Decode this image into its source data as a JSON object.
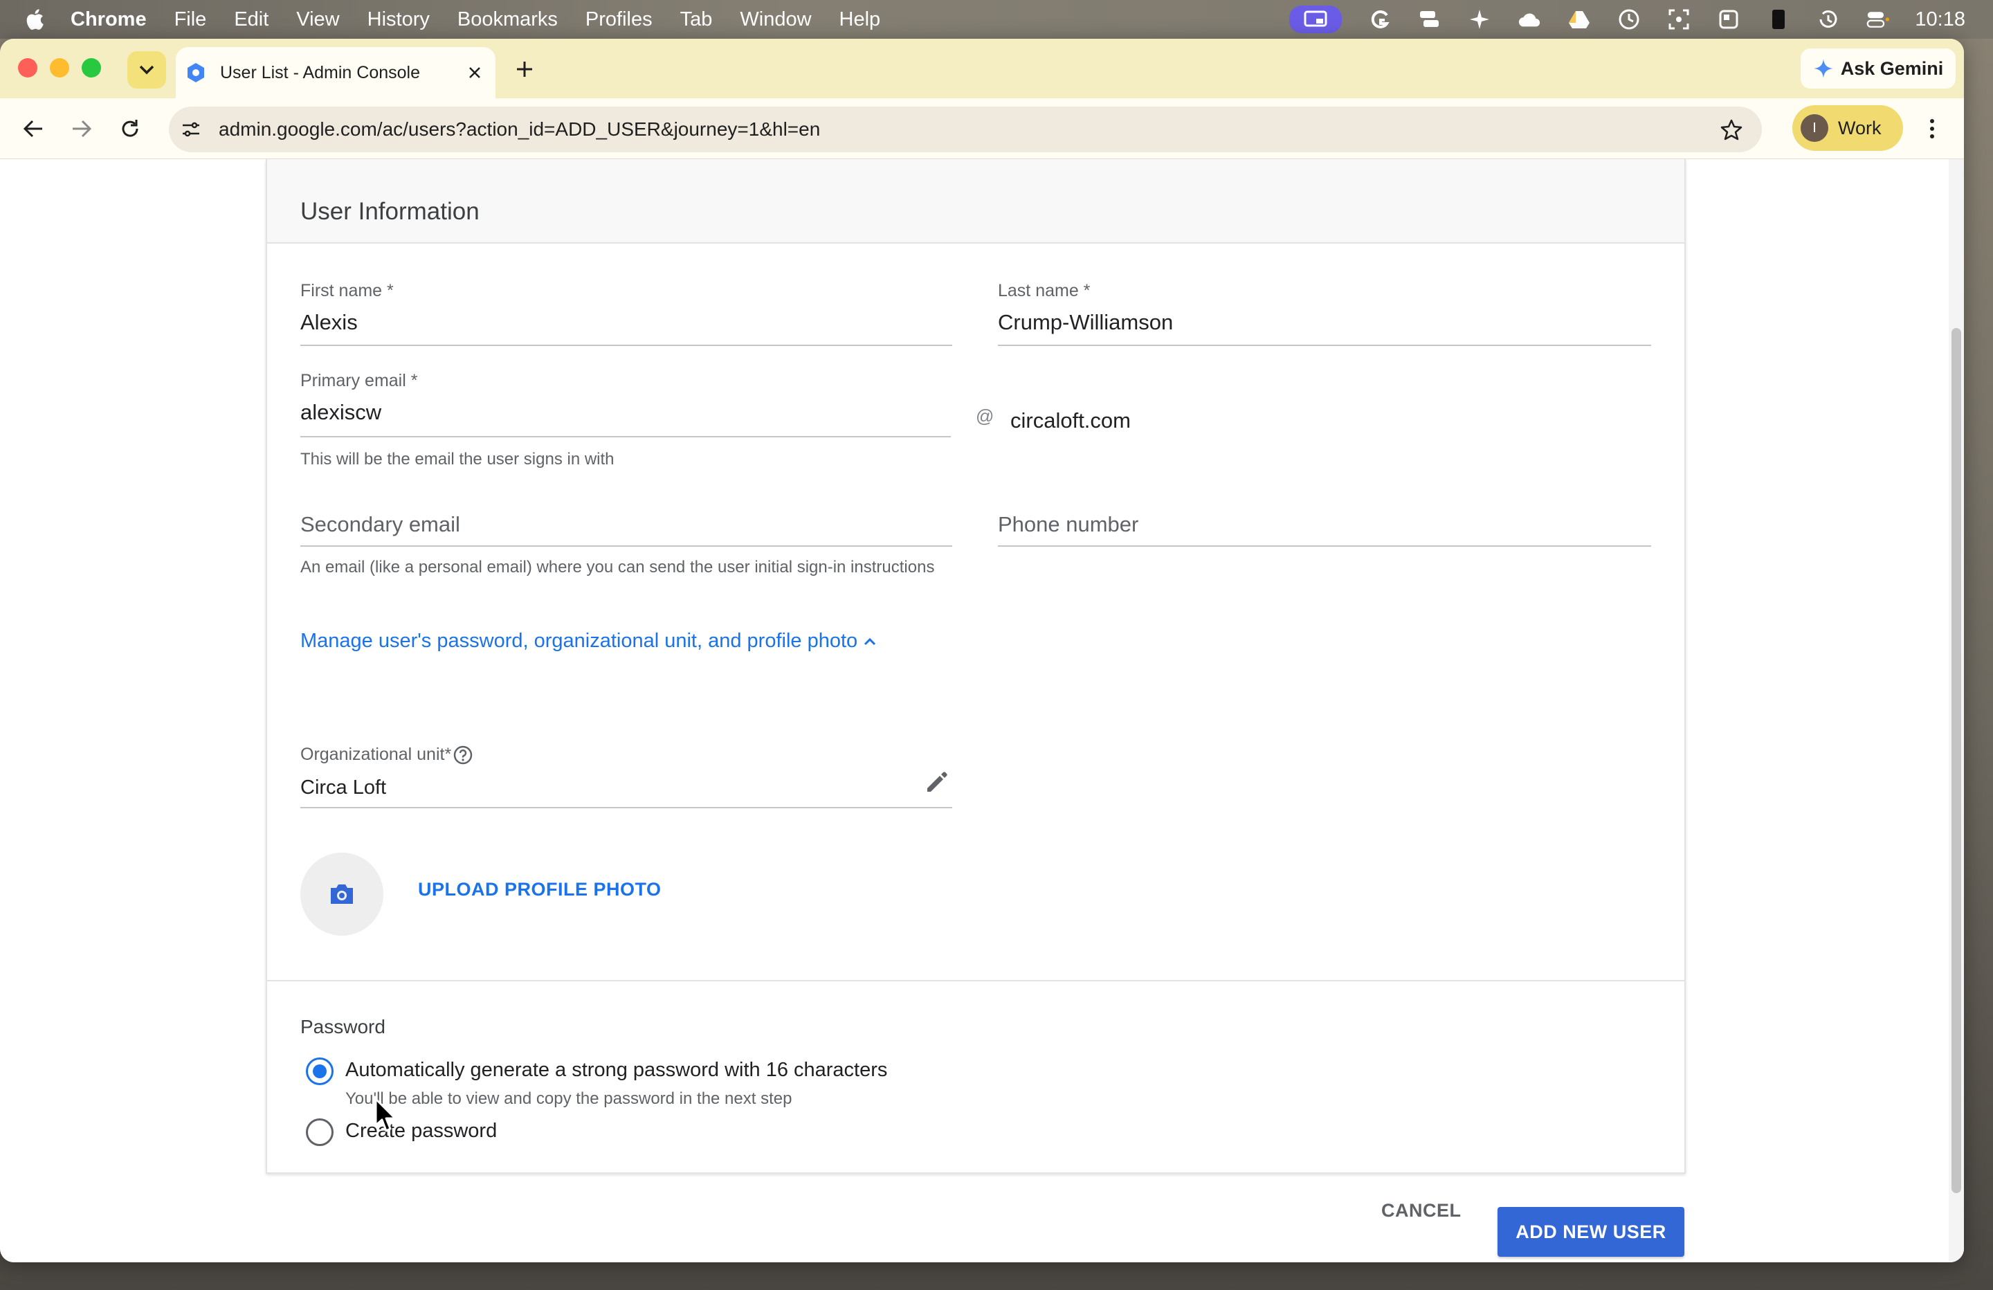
{
  "menubar": {
    "app_name": "Chrome",
    "items": [
      "File",
      "Edit",
      "View",
      "History",
      "Bookmarks",
      "Profiles",
      "Tab",
      "Window",
      "Help"
    ],
    "clock": "10:18"
  },
  "browser": {
    "tab_title": "User List - Admin Console",
    "url": "admin.google.com/ac/users?action_id=ADD_USER&journey=1&hl=en",
    "gemini_label": "Ask Gemini",
    "profile_initial": "I",
    "profile_label": "Work"
  },
  "form": {
    "section_title": "User Information",
    "first_name": {
      "label": "First name *",
      "value": "Alexis"
    },
    "last_name": {
      "label": "Last name *",
      "value": "Crump-Williamson"
    },
    "primary_email": {
      "label": "Primary email *",
      "value": "alexiscw",
      "at": "@",
      "domain": "circaloft.com",
      "hint": "This will be the email the user signs in with"
    },
    "secondary_email": {
      "placeholder": "Secondary email",
      "hint": "An email (like a personal email) where you can send the user initial sign-in instructions"
    },
    "phone": {
      "placeholder": "Phone number"
    },
    "manage_link": "Manage user's password, organizational unit, and profile photo",
    "org_unit": {
      "label": "Organizational unit*",
      "value": "Circa Loft"
    },
    "upload_photo": "UPLOAD PROFILE PHOTO",
    "password": {
      "title": "Password",
      "options": [
        {
          "label": "Automatically generate a strong password with 16 characters",
          "sub": "You'll be able to view and copy the password in the next step",
          "checked": true
        },
        {
          "label": "Create password",
          "checked": false
        }
      ]
    }
  },
  "actions": {
    "cancel": "CANCEL",
    "add": "ADD NEW USER"
  },
  "colors": {
    "accent": "#1a73e8",
    "primary_button": "#3367d6",
    "tabstrip": "#f6eec3",
    "profile_chip": "#f1da6f"
  }
}
